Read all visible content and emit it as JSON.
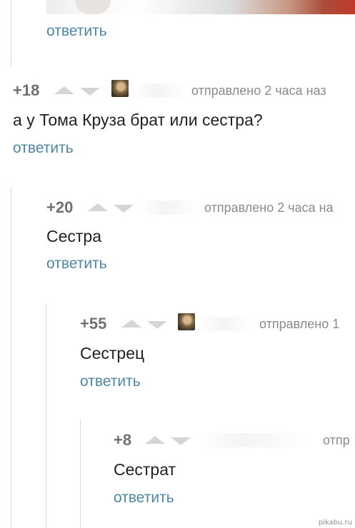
{
  "image_top": {
    "description": "cropped photo above"
  },
  "reply_top": "ответить",
  "comments": [
    {
      "rating": "+18",
      "sent": "отправлено 2 часа наз",
      "text": "а у Тома Круза брат или сестра?",
      "reply": "ответить",
      "icon": "avatar"
    },
    {
      "rating": "+20",
      "sent": "отправлено 2 часа на",
      "text": "Сестра",
      "reply": "ответить",
      "icon": "none"
    },
    {
      "rating": "+55",
      "sent": "отправлено 1",
      "text": "Сестрец",
      "reply": "ответить",
      "icon": "avatar"
    },
    {
      "rating": "+8",
      "sent": "отпр",
      "text": "Сестрат",
      "reply": "ответить",
      "icon": "none"
    }
  ],
  "watermark": "pikabu.ru",
  "colors": {
    "link": "#4f86a6",
    "rating": "#707070",
    "arrow": "#d5d5d5",
    "meta": "#8a8a8a"
  }
}
